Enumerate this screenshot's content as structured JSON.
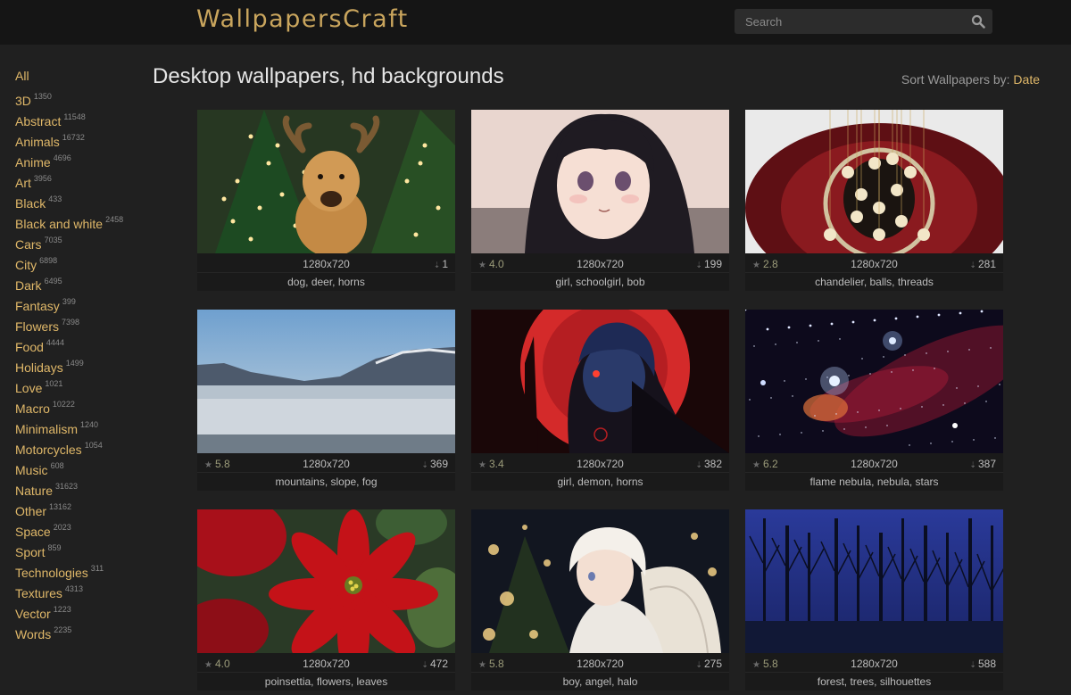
{
  "header": {
    "logo": "WallpapersCraft",
    "search_placeholder": "Search"
  },
  "sidebar": {
    "all_label": "All",
    "categories": [
      {
        "name": "3D",
        "count": "1350"
      },
      {
        "name": "Abstract",
        "count": "11548"
      },
      {
        "name": "Animals",
        "count": "16732"
      },
      {
        "name": "Anime",
        "count": "4696"
      },
      {
        "name": "Art",
        "count": "3956"
      },
      {
        "name": "Black",
        "count": "433"
      },
      {
        "name": "Black and white",
        "count": "2458"
      },
      {
        "name": "Cars",
        "count": "7035"
      },
      {
        "name": "City",
        "count": "6898"
      },
      {
        "name": "Dark",
        "count": "6495"
      },
      {
        "name": "Fantasy",
        "count": "399"
      },
      {
        "name": "Flowers",
        "count": "7398"
      },
      {
        "name": "Food",
        "count": "4444"
      },
      {
        "name": "Holidays",
        "count": "1499"
      },
      {
        "name": "Love",
        "count": "1021"
      },
      {
        "name": "Macro",
        "count": "10222"
      },
      {
        "name": "Minimalism",
        "count": "1240"
      },
      {
        "name": "Motorcycles",
        "count": "1054"
      },
      {
        "name": "Music",
        "count": "608"
      },
      {
        "name": "Nature",
        "count": "31623"
      },
      {
        "name": "Other",
        "count": "13162"
      },
      {
        "name": "Space",
        "count": "2023"
      },
      {
        "name": "Sport",
        "count": "859"
      },
      {
        "name": "Technologies",
        "count": "311"
      },
      {
        "name": "Textures",
        "count": "4313"
      },
      {
        "name": "Vector",
        "count": "1223"
      },
      {
        "name": "Words",
        "count": "2235"
      }
    ]
  },
  "main": {
    "title": "Desktop wallpapers, hd backgrounds",
    "sort_label": "Sort Wallpapers by:",
    "sort_value": "Date"
  },
  "wallpapers": [
    {
      "rating": "",
      "resolution": "1280x720",
      "downloads": "1",
      "tags": "dog, deer, horns",
      "scene": "dog-christmas"
    },
    {
      "rating": "4.0",
      "resolution": "1280x720",
      "downloads": "199",
      "tags": "girl, schoolgirl, bob",
      "scene": "anime-girl"
    },
    {
      "rating": "2.8",
      "resolution": "1280x720",
      "downloads": "281",
      "tags": "chandelier, balls, threads",
      "scene": "chandelier"
    },
    {
      "rating": "5.8",
      "resolution": "1280x720",
      "downloads": "369",
      "tags": "mountains, slope, fog",
      "scene": "mountains-fog"
    },
    {
      "rating": "3.4",
      "resolution": "1280x720",
      "downloads": "382",
      "tags": "girl, demon, horns",
      "scene": "demon-girl"
    },
    {
      "rating": "6.2",
      "resolution": "1280x720",
      "downloads": "387",
      "tags": "flame nebula, nebula, stars",
      "scene": "nebula"
    },
    {
      "rating": "4.0",
      "resolution": "1280x720",
      "downloads": "472",
      "tags": "poinsettia, flowers, leaves",
      "scene": "poinsettia"
    },
    {
      "rating": "5.8",
      "resolution": "1280x720",
      "downloads": "275",
      "tags": "boy, angel, halo",
      "scene": "angel-boy"
    },
    {
      "rating": "5.8",
      "resolution": "1280x720",
      "downloads": "588",
      "tags": "forest, trees, silhouettes",
      "scene": "forest-night"
    }
  ],
  "colors": {
    "accent": "#e0b869",
    "background": "#202020",
    "topbar": "#151515"
  }
}
